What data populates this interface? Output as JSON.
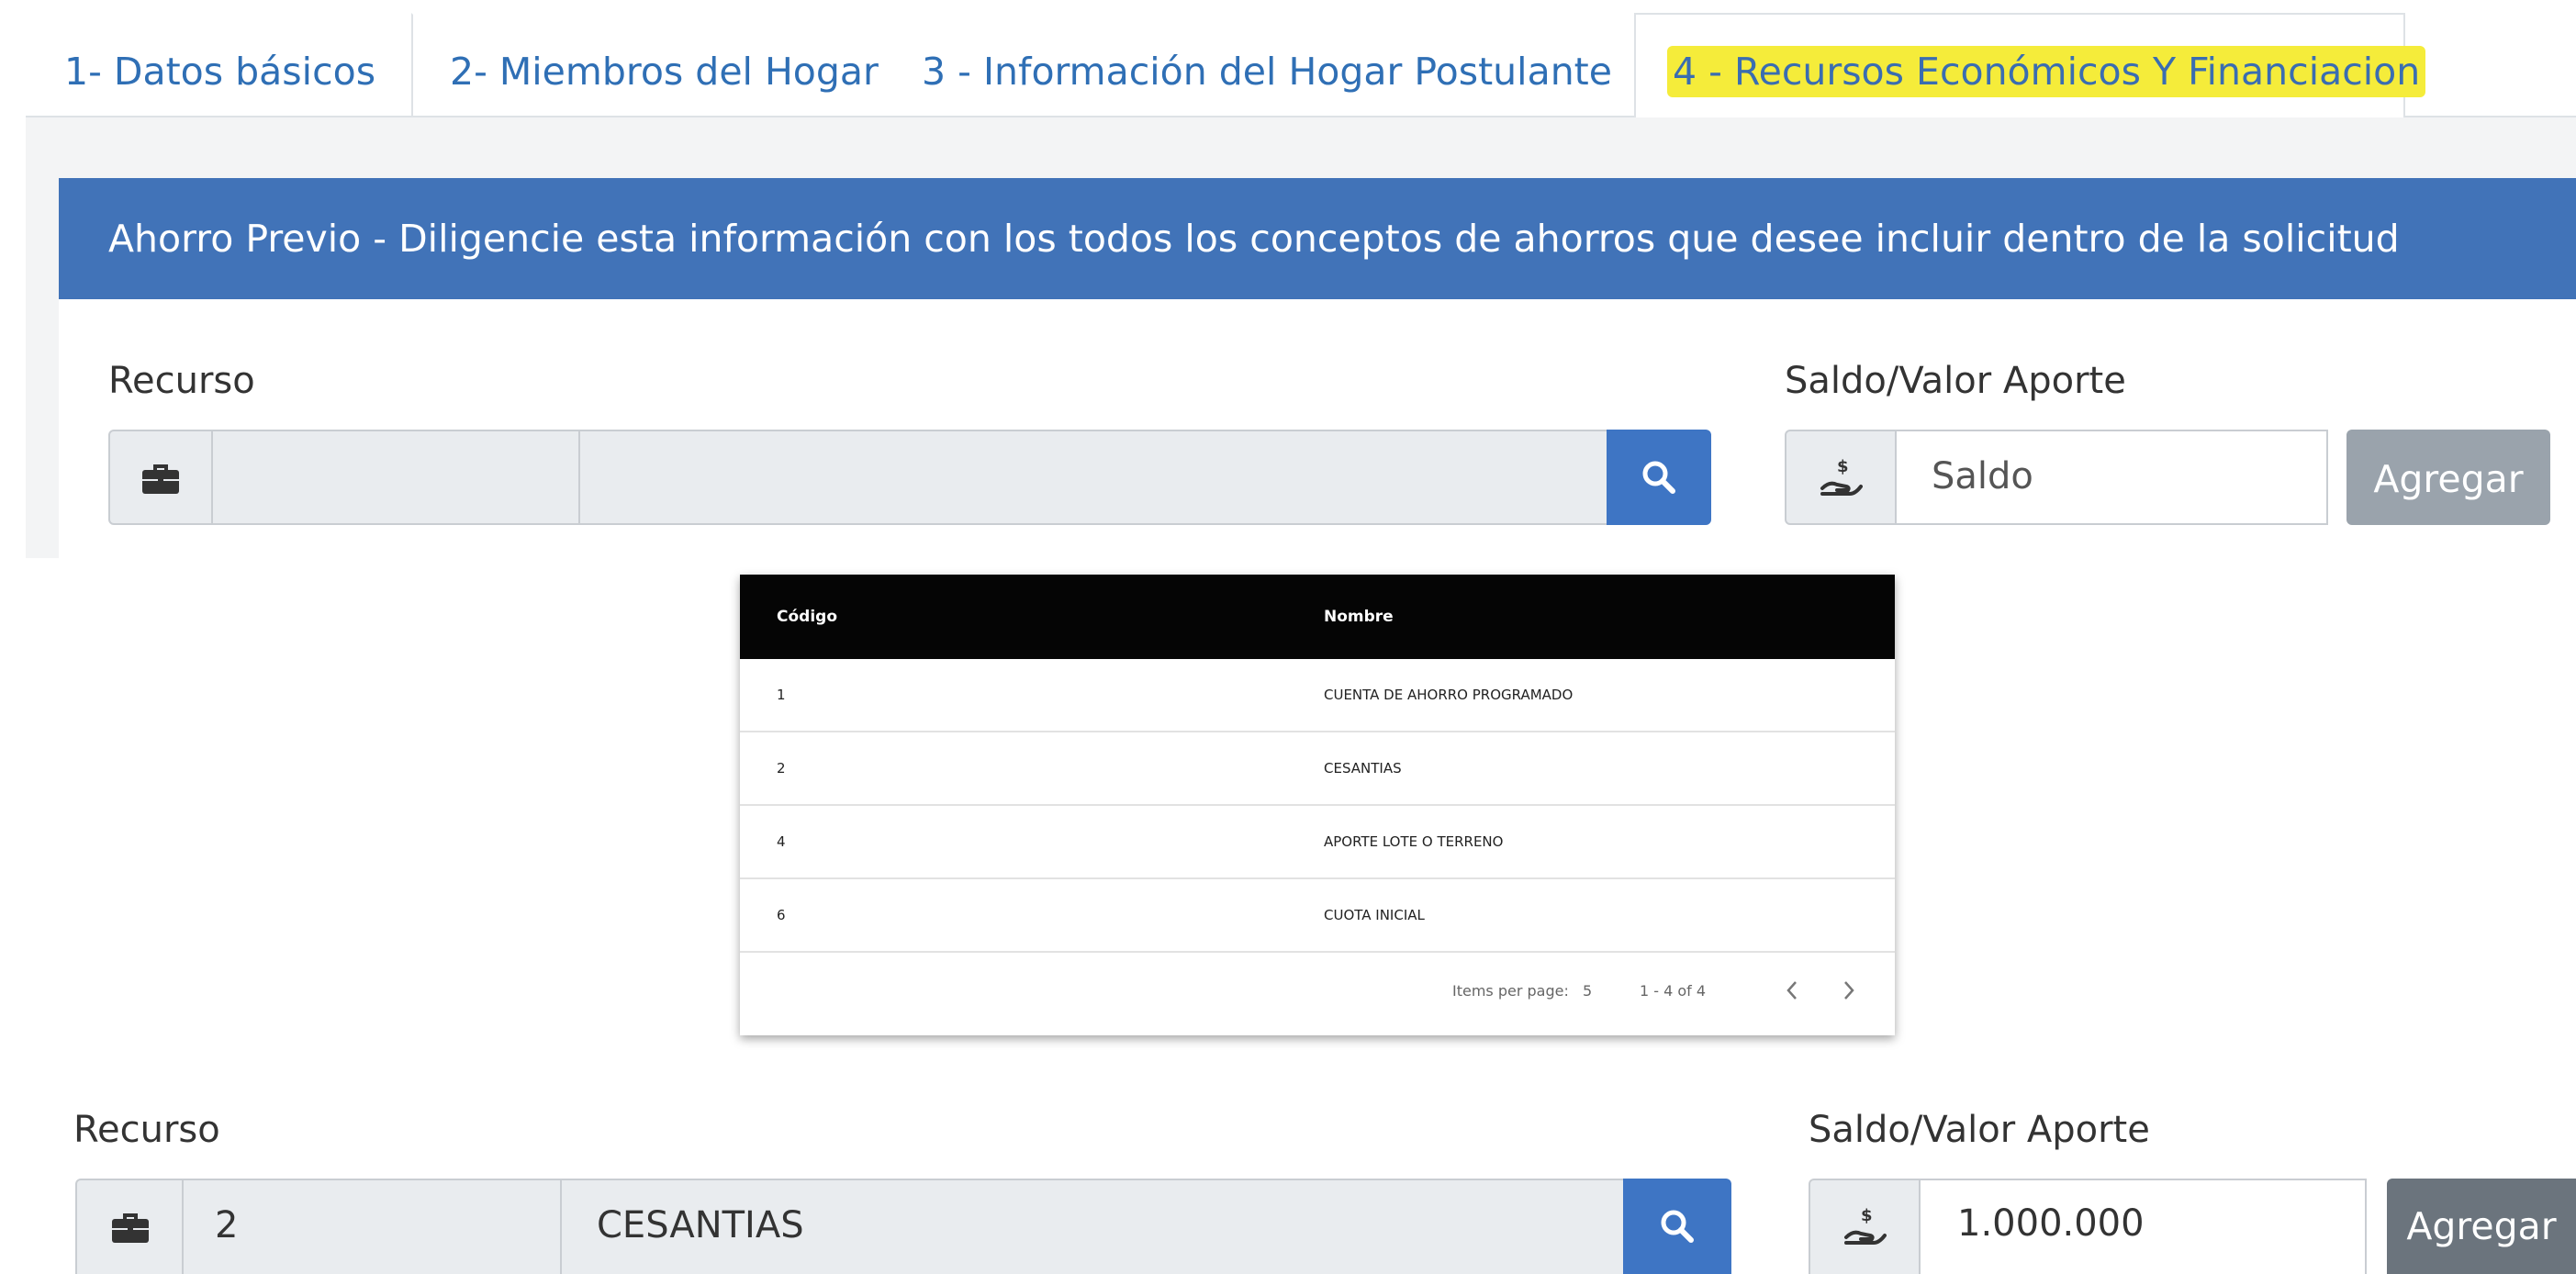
{
  "tabs": [
    {
      "label": "1- Datos básicos"
    },
    {
      "label": "2- Miembros del Hogar"
    },
    {
      "label": "3 - Información del Hogar Postulante"
    },
    {
      "label": "4 - Recursos Económicos Y Financiacion"
    }
  ],
  "panel": {
    "title": "Ahorro Previo - Diligencie esta información con los todos los conceptos de ahorros que desee incluir dentro de la solicitud"
  },
  "form_top": {
    "recurso_label": "Recurso",
    "codigo_value": "",
    "nombre_value": "",
    "saldo_label": "Saldo/Valor Aporte",
    "saldo_placeholder": "Saldo",
    "add_button": "Agregar"
  },
  "lookup_table": {
    "columns": [
      "Código",
      "Nombre"
    ],
    "rows": [
      {
        "codigo": "1",
        "nombre": "CUENTA DE AHORRO PROGRAMADO"
      },
      {
        "codigo": "2",
        "nombre": "CESANTIAS"
      },
      {
        "codigo": "4",
        "nombre": "APORTE LOTE O TERRENO"
      },
      {
        "codigo": "6",
        "nombre": "CUOTA INICIAL"
      }
    ],
    "items_per_page_label": "Items per page:",
    "items_per_page_value": "5",
    "range": "1 - 4 of 4"
  },
  "form_bottom": {
    "recurso_label": "Recurso",
    "codigo_value": "2",
    "nombre_value": "CESANTIAS",
    "saldo_label": "Saldo/Valor Aporte",
    "saldo_value": "1.000.000",
    "add_button": "Agregar"
  },
  "colors": {
    "primary": "#4173b8",
    "search_button": "#3e75c4",
    "highlight": "#f5ec3a",
    "table_header": "#050505",
    "disabled_button": "#9aa3ac",
    "enabled_button": "#6b747d"
  },
  "icons": {
    "recurso_icon": "briefcase-icon",
    "search_icon": "search-icon",
    "saldo_icon": "hand-dollar-icon",
    "prev_icon": "chevron-left-icon",
    "next_icon": "chevron-right-icon"
  }
}
